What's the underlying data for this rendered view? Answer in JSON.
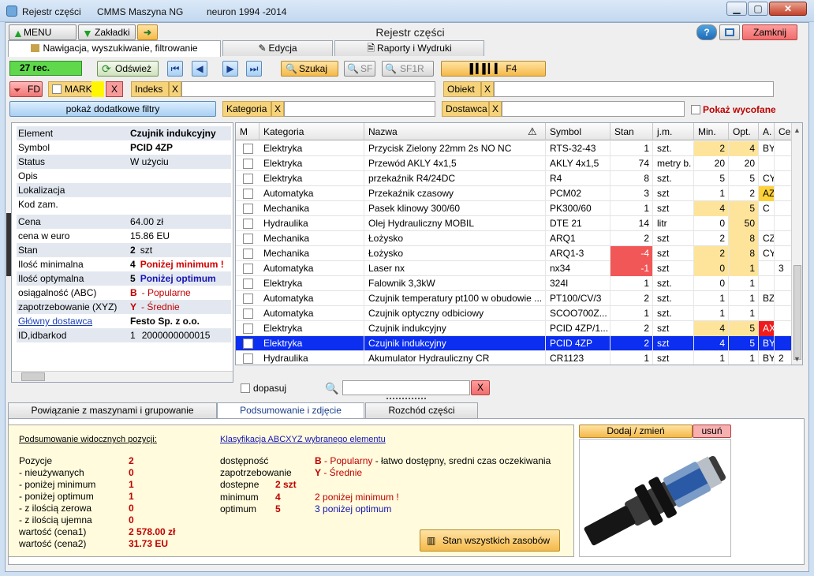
{
  "window": {
    "app": "Rejestr części",
    "product": "CMMS Maszyna NG",
    "copyright": "neuron 1994 -2014",
    "min": "▁",
    "max": "▢",
    "close": "✕"
  },
  "toolbar": {
    "menu": "MENU",
    "bookmarks": "Zakładki",
    "title": "Rejestr części",
    "help": "?",
    "close": "Zamknij"
  },
  "tabs": [
    "Nawigacja, wyszukiwanie, filtrowanie",
    "Edycja",
    "Raporty i Wydruki"
  ],
  "nav": {
    "records": "27 rec.",
    "refresh": "Odśwież",
    "search": "Szukaj",
    "sf": "SF",
    "sf1r": "SF1R",
    "f4": "F4"
  },
  "filters": {
    "fd": "FD",
    "mark": "MARK",
    "x": "X",
    "indeks": "Indeks",
    "obiekt": "Obiekt",
    "more": "pokaż dodatkowe filtry",
    "kategoria": "Kategoria",
    "dostawca": "Dostawca",
    "show_withdrawn": "Pokaż wycofane"
  },
  "details": {
    "rows": [
      {
        "k": "Element",
        "v": "Czujnik indukcyjny",
        "v2": "",
        "style": "bold"
      },
      {
        "k": "Symbol",
        "v": "PCID 4ZP",
        "v2": "",
        "style": "bold"
      },
      {
        "k": "Status",
        "v": "W użyciu",
        "v2": "",
        "style": ""
      },
      {
        "k": "Opis",
        "v": "",
        "v2": "",
        "style": ""
      },
      {
        "k": "Lokalizacja",
        "v": "",
        "v2": "",
        "style": ""
      },
      {
        "k": "Kod zam.",
        "v": "",
        "v2": "",
        "style": ""
      },
      {
        "k": "Cena",
        "v": "64.00 zł",
        "v2": "",
        "style": ""
      },
      {
        "k": "cena w euro",
        "v": "15.86 EU",
        "v2": "",
        "style": ""
      },
      {
        "k": "Stan",
        "v": "2",
        "v2": "szt",
        "style": "boldnum"
      },
      {
        "k": "Ilość minimalna",
        "v": "4",
        "v2": "Poniżej minimum !",
        "style": "min"
      },
      {
        "k": "Ilość optymalna",
        "v": "5",
        "v2": "Poniżej optimum",
        "style": "opt"
      },
      {
        "k": "osiągalność (ABC)",
        "v": "B",
        "v2": "- Popularne",
        "style": "abc"
      },
      {
        "k": "zapotrzebowanie (XYZ)",
        "v": "Y",
        "v2": "- Średnie",
        "style": "abc"
      },
      {
        "k": "Główny dostawca",
        "v": "Festo Sp. z o.o.",
        "v2": "",
        "style": "link"
      },
      {
        "k": "ID,idbarkod",
        "v": "1",
        "v2": "2000000000015",
        "style": ""
      }
    ]
  },
  "grid": {
    "headers": [
      "M",
      "Kategoria",
      "Nazwa",
      "Symbol",
      "Stan",
      "j.m.",
      "Min.",
      "Opt.",
      "A.",
      "Cen"
    ],
    "rows": [
      {
        "kat": "Elektryka",
        "nazwa": "Przycisk Zielony 22mm  2s NO NC",
        "symbol": "RTS-32-43",
        "stan": "1",
        "jm": "szt.",
        "min": "2",
        "opt": "4",
        "a": "BY",
        "cen": "",
        "minHl": "y",
        "optHl": "y",
        "aHl": "",
        "stanHl": ""
      },
      {
        "kat": "Elektryka",
        "nazwa": "Przewód AKLY 4x1,5",
        "symbol": "AKLY 4x1,5",
        "stan": "74",
        "jm": "metry b.",
        "min": "20",
        "opt": "20",
        "a": "",
        "cen": "",
        "minHl": "",
        "optHl": "",
        "aHl": "",
        "stanHl": ""
      },
      {
        "kat": "Elektryka",
        "nazwa": "przekaźnik R4/24DC",
        "symbol": "R4",
        "stan": "8",
        "jm": "szt.",
        "min": "5",
        "opt": "5",
        "a": "CY",
        "cen": "",
        "minHl": "",
        "optHl": "",
        "aHl": "",
        "stanHl": ""
      },
      {
        "kat": "Automatyka",
        "nazwa": "Przekaźnik czasowy",
        "symbol": "PCM02",
        "stan": "3",
        "jm": "szt",
        "min": "1",
        "opt": "2",
        "a": "AZ",
        "cen": "",
        "minHl": "",
        "optHl": "",
        "aHl": "y",
        "stanHl": ""
      },
      {
        "kat": "Mechanika",
        "nazwa": "Pasek klinowy 300/60",
        "symbol": "PK300/60",
        "stan": "1",
        "jm": "szt",
        "min": "4",
        "opt": "5",
        "a": "C",
        "cen": "",
        "minHl": "y",
        "optHl": "y",
        "aHl": "",
        "stanHl": ""
      },
      {
        "kat": "Hydraulika",
        "nazwa": "Olej Hydrauliczny MOBIL",
        "symbol": "DTE 21",
        "stan": "14",
        "jm": "litr",
        "min": "0",
        "opt": "50",
        "a": "",
        "cen": "",
        "minHl": "",
        "optHl": "y",
        "aHl": "",
        "stanHl": ""
      },
      {
        "kat": "Mechanika",
        "nazwa": "Łożysko",
        "symbol": "ARQ1",
        "stan": "2",
        "jm": "szt",
        "min": "2",
        "opt": "8",
        "a": "CZ",
        "cen": "",
        "minHl": "",
        "optHl": "y",
        "aHl": "",
        "stanHl": ""
      },
      {
        "kat": "Mechanika",
        "nazwa": "Łożysko",
        "symbol": "ARQ1-3",
        "stan": "-4",
        "jm": "szt",
        "min": "2",
        "opt": "8",
        "a": "CY",
        "cen": "",
        "minHl": "y",
        "optHl": "y",
        "aHl": "",
        "stanHl": "r"
      },
      {
        "kat": "Automatyka",
        "nazwa": "Laser nx",
        "symbol": "nx34",
        "stan": "-1",
        "jm": "szt",
        "min": "0",
        "opt": "1",
        "a": "",
        "cen": "3",
        "minHl": "y",
        "optHl": "y",
        "aHl": "",
        "stanHl": "r"
      },
      {
        "kat": "Elektryka",
        "nazwa": "Falownik 3,3kW",
        "symbol": "324I",
        "stan": "1",
        "jm": "szt.",
        "min": "0",
        "opt": "1",
        "a": "",
        "cen": "",
        "minHl": "",
        "optHl": "",
        "aHl": "",
        "stanHl": ""
      },
      {
        "kat": "Automatyka",
        "nazwa": "Czujnik temperatury pt100 w obudowie ...",
        "symbol": "PT100/CV/3",
        "stan": "2",
        "jm": "szt.",
        "min": "1",
        "opt": "1",
        "a": "BZ",
        "cen": "",
        "minHl": "",
        "optHl": "",
        "aHl": "",
        "stanHl": ""
      },
      {
        "kat": "Automatyka",
        "nazwa": "Czujnik optyczny odbiciowy",
        "symbol": "SCOO700Z...",
        "stan": "1",
        "jm": "szt.",
        "min": "1",
        "opt": "1",
        "a": "",
        "cen": "",
        "minHl": "",
        "optHl": "",
        "aHl": "",
        "stanHl": ""
      },
      {
        "kat": "Elektryka",
        "nazwa": "Czujnik indukcyjny",
        "symbol": "PCID 4ZP/1...",
        "stan": "2",
        "jm": "szt",
        "min": "4",
        "opt": "5",
        "a": "AX",
        "cen": "",
        "minHl": "y",
        "optHl": "y",
        "aHl": "r",
        "stanHl": ""
      },
      {
        "kat": "Elektryka",
        "nazwa": "Czujnik indukcyjny",
        "symbol": "PCID 4ZP",
        "stan": "2",
        "jm": "szt",
        "min": "4",
        "opt": "5",
        "a": "BY",
        "cen": "",
        "minHl": "",
        "optHl": "",
        "aHl": "",
        "stanHl": "",
        "selected": true
      },
      {
        "kat": "Hydraulika",
        "nazwa": "Akumulator Hydrauliczny CR",
        "symbol": "CR1123",
        "stan": "1",
        "jm": "szt",
        "min": "1",
        "opt": "1",
        "a": "BY",
        "cen": "2",
        "minHl": "",
        "optHl": "",
        "aHl": "",
        "stanHl": ""
      }
    ]
  },
  "below_grid": {
    "fit": "dopasuj",
    "x": "X"
  },
  "bottom_tabs": [
    "Powiązanie z maszynami i grupowanie",
    "Podsumowanie i zdjęcie",
    "Rozchód części"
  ],
  "summary": {
    "title_left": "Podsumowanie widocznych pozycji:",
    "left": [
      {
        "k": "Pozycje",
        "v": "2"
      },
      {
        "k": "- nieużywanych",
        "v": "0"
      },
      {
        "k": "- poniżej minimum",
        "v": "1"
      },
      {
        "k": "- poniżej optimum",
        "v": "1"
      },
      {
        "k": "- z ilością zerowa",
        "v": "0"
      },
      {
        "k": "- z ilością ujemna",
        "v": "0"
      },
      {
        "k": "wartość (cena1)",
        "v": "2 578.00 zł"
      },
      {
        "k": "wartość (cena2)",
        "v": "31.73 EU"
      }
    ],
    "title_right": "Klasyfikacja ABCXYZ wybranego elementu",
    "dost_k": "dostępność",
    "dost_v": "B",
    "dost_d": "- Popularny",
    "dost_rest": " - łatwo dostępny, sredni czas oczekiwania",
    "zap_k": "zapotrzebowanie",
    "zap_v": "Y",
    "zap_d": " - Średnie",
    "dostepne_k": "dostepne",
    "dostepne_v": "2 szt",
    "min_k": "minimum",
    "min_v": "4",
    "min_n": "2",
    "min_t": "poniżej minimum !",
    "opt_k": "optimum",
    "opt_v": "5",
    "opt_n": "3",
    "opt_t": "poniżej optimum",
    "all_btn": "Stan wszystkich zasobów"
  },
  "photo": {
    "add": "Dodaj / zmień",
    "remove": "usuń"
  },
  "colors": {
    "selected_row": "#0b2ef0",
    "yellow_hl": "#fde49a",
    "red_hl": "#f25757",
    "accent_orange": "#f5b94a",
    "green": "#5fd84c"
  }
}
